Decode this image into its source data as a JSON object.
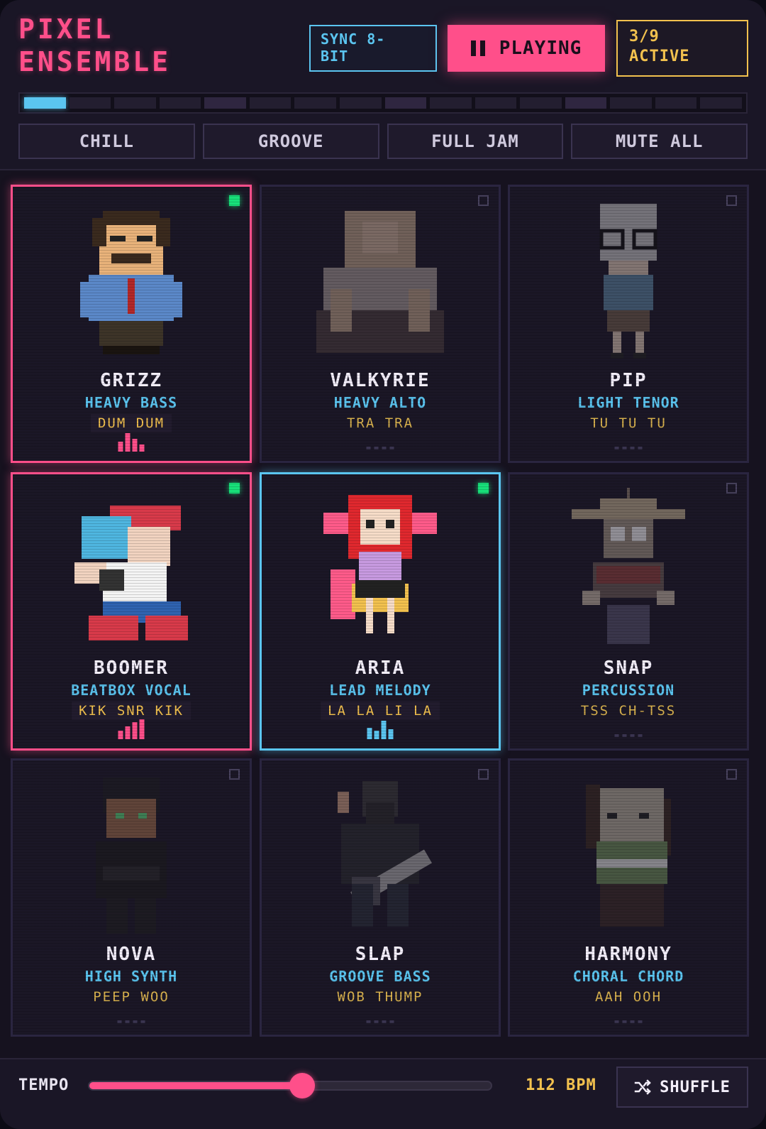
{
  "header": {
    "title_line1": "PIXEL",
    "title_line2": "ENSEMBLE",
    "sync_line1": "SYNC 8-",
    "sync_line2": "BIT",
    "play_label": "PLAYING",
    "active_count": "3/9",
    "active_label": "ACTIVE"
  },
  "sequencer": {
    "steps": 16,
    "current_step": 1
  },
  "presets": [
    "CHILL",
    "GROOVE",
    "FULL JAM",
    "MUTE ALL"
  ],
  "characters": [
    {
      "name": "GRIZZ",
      "role": "HEAVY BASS",
      "syllables": "DUM DUM",
      "active": true,
      "icon": "bald-mustache-man-icon"
    },
    {
      "name": "VALKYRIE",
      "role": "HEAVY ALTO",
      "syllables": "TRA TRA",
      "active": false,
      "icon": "long-hair-singer-icon"
    },
    {
      "name": "PIP",
      "role": "LIGHT TENOR",
      "syllables": "TU TU TU",
      "active": false,
      "icon": "glasses-kid-icon"
    },
    {
      "name": "BOOMER",
      "role": "BEATBOX VOCAL",
      "syllables": "KIK SNR KIK",
      "active": true,
      "icon": "cap-rapper-icon"
    },
    {
      "name": "ARIA",
      "role": "LEAD MELODY",
      "syllables": "LA LA LI LA",
      "active": true,
      "icon": "red-hair-singer-icon"
    },
    {
      "name": "SNAP",
      "role": "PERCUSSION",
      "syllables": "TSS CH-TSS",
      "active": false,
      "icon": "drummer-robot-icon"
    },
    {
      "name": "NOVA",
      "role": "HIGH SYNTH",
      "syllables": "PEEP WOO",
      "active": false,
      "icon": "synth-kid-icon"
    },
    {
      "name": "SLAP",
      "role": "GROOVE BASS",
      "syllables": "WOB THUMP",
      "active": false,
      "icon": "bass-guitarist-icon"
    },
    {
      "name": "HARMONY",
      "role": "CHORAL CHORD",
      "syllables": "AAH OOH",
      "active": false,
      "icon": "choir-creature-icon"
    }
  ],
  "footer": {
    "tempo_label": "TEMPO",
    "tempo_fraction": 0.53,
    "bpm": "112 BPM",
    "shuffle_label": "SHUFFLE"
  },
  "colors": {
    "accent": "#ff4f8a",
    "cyan": "#5bc5f0",
    "gold": "#f2c14e",
    "live": "#18e07a"
  }
}
